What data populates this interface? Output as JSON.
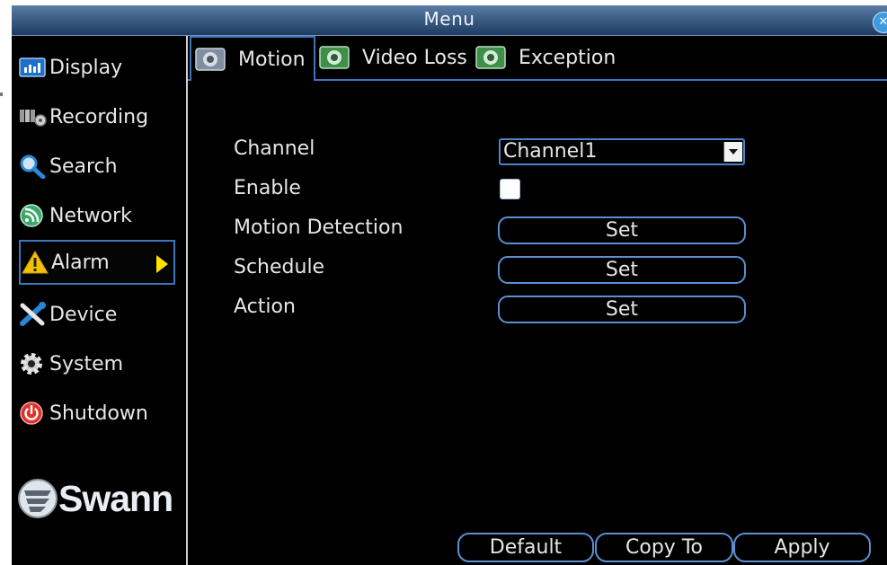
{
  "window": {
    "title": "Menu"
  },
  "sidebar": {
    "items": [
      {
        "label": "Display",
        "icon": "display-icon"
      },
      {
        "label": "Recording",
        "icon": "recording-icon"
      },
      {
        "label": "Search",
        "icon": "search-icon"
      },
      {
        "label": "Network",
        "icon": "network-icon"
      },
      {
        "label": "Alarm",
        "icon": "alarm-icon",
        "selected": true
      },
      {
        "label": "Device",
        "icon": "device-icon"
      },
      {
        "label": "System",
        "icon": "system-icon"
      },
      {
        "label": "Shutdown",
        "icon": "shutdown-icon"
      }
    ],
    "logo_text": "Swann"
  },
  "tabs": [
    {
      "label": "Motion",
      "active": true
    },
    {
      "label": "Video Loss"
    },
    {
      "label": "Exception"
    }
  ],
  "form": {
    "channel_label": "Channel",
    "channel_value": "Channel1",
    "enable_label": "Enable",
    "enable_checked": false,
    "motion_detection_label": "Motion Detection",
    "schedule_label": "Schedule",
    "action_label": "Action",
    "set_label": "Set"
  },
  "footer": {
    "default_label": "Default",
    "copy_to_label": "Copy To",
    "apply_label": "Apply"
  },
  "colors": {
    "accent": "#3c76bf",
    "title_bar": "#37587f",
    "background": "#000000",
    "selected_arrow": "#ffe000"
  }
}
